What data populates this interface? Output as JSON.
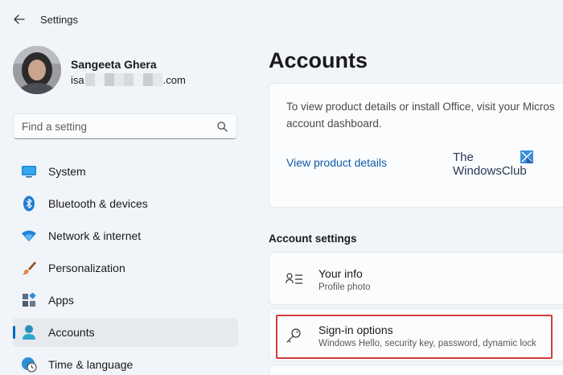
{
  "window": {
    "title": "Settings"
  },
  "profile": {
    "name": "Sangeeta Ghera",
    "email_prefix": "isa",
    "email_suffix": ".com"
  },
  "search": {
    "placeholder": "Find a setting",
    "value": ""
  },
  "sidebar": {
    "items": [
      {
        "label": "System",
        "icon": "monitor-icon",
        "active": false
      },
      {
        "label": "Bluetooth & devices",
        "icon": "bluetooth-icon",
        "active": false
      },
      {
        "label": "Network & internet",
        "icon": "wifi-icon",
        "active": false
      },
      {
        "label": "Personalization",
        "icon": "paintbrush-icon",
        "active": false
      },
      {
        "label": "Apps",
        "icon": "apps-icon",
        "active": false
      },
      {
        "label": "Accounts",
        "icon": "person-icon",
        "active": true
      },
      {
        "label": "Time & language",
        "icon": "globe-clock-icon",
        "active": false
      }
    ]
  },
  "main": {
    "title": "Accounts",
    "office_card": {
      "line1": "To view product details or install Office, visit your Micros",
      "line2": "account dashboard.",
      "link": "View product details"
    },
    "watermark": {
      "line1": "The",
      "line2": "WindowsClub"
    },
    "section_label": "Account settings",
    "settings": [
      {
        "title": "Your info",
        "subtitle": "Profile photo",
        "icon": "your-info-icon"
      },
      {
        "title": "Sign-in options",
        "subtitle": "Windows Hello, security key, password, dynamic lock",
        "icon": "key-icon"
      }
    ]
  },
  "colors": {
    "accent": "#0067c0",
    "highlight": "#d23c3c",
    "background": "#f1f4f9",
    "link": "#0f5aa8"
  }
}
